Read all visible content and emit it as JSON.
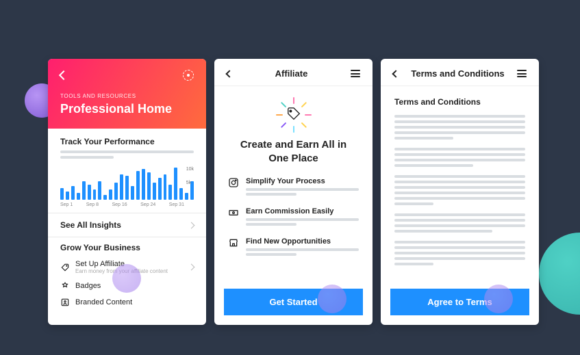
{
  "card1": {
    "eyebrow": "TOOLS AND RESOURCES",
    "title": "Professional Home",
    "track_heading": "Track Your Performance",
    "see_all_label": "See All Insights",
    "grow_heading": "Grow Your Business",
    "biz": {
      "affiliate": {
        "label": "Set Up Affiliate",
        "sub": "Earn money from your affiliate content"
      },
      "badges": {
        "label": "Badges"
      },
      "branded": {
        "label": "Branded Content"
      }
    }
  },
  "card2": {
    "header_title": "Affiliate",
    "headline": "Create and Earn All in One Place",
    "features": {
      "simplify": "Simplify Your Process",
      "commission": "Earn Commission Easily",
      "opportunities": "Find New Opportunities"
    },
    "cta_label": "Get Started"
  },
  "card3": {
    "header_title": "Terms and Conditions",
    "content_heading": "Terms and Conditions",
    "cta_label": "Agree to Terms"
  },
  "chart_data": {
    "type": "bar",
    "categories": [
      "Sep 1",
      "Sep 8",
      "Sep 16",
      "Sep 24",
      "Sep 31"
    ],
    "values": [
      3.5,
      2.5,
      4,
      2,
      5.5,
      4.5,
      3,
      5.5,
      1.5,
      3,
      5,
      7.5,
      7,
      4,
      8.5,
      9,
      8,
      5,
      6.5,
      7.5,
      4.5,
      9.5,
      3.5,
      2,
      5.5
    ],
    "ytick_labels": [
      "10k",
      "5k"
    ],
    "ylim": [
      0,
      10
    ],
    "xlabel": "",
    "ylabel": ""
  },
  "colors": {
    "accent": "#1e90ff",
    "gradient_start": "#ff1f6e",
    "gradient_end": "#ff6b3d"
  }
}
